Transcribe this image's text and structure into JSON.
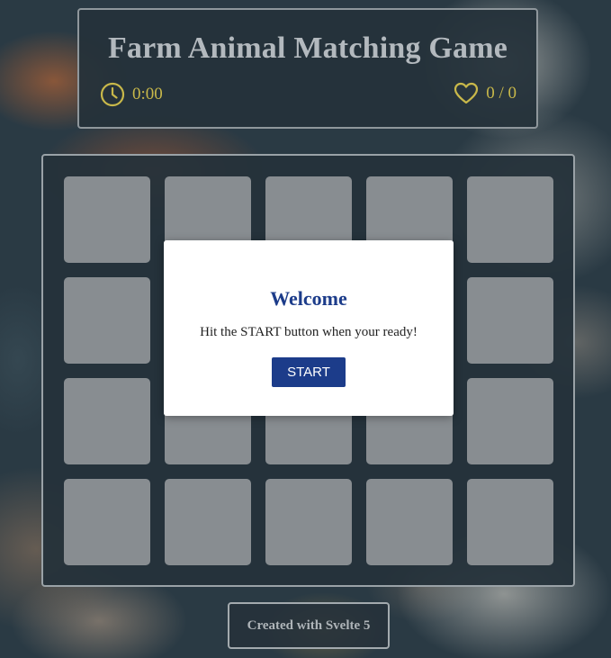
{
  "header": {
    "title": "Farm Animal Matching Game",
    "timer": {
      "icon": "clock-icon",
      "value": "0:00"
    },
    "score": {
      "icon": "heart-icon",
      "value": "0 / 0"
    }
  },
  "board": {
    "card_count": 20,
    "columns": 5,
    "rows": 4,
    "card_state": "face-down"
  },
  "modal": {
    "title": "Welcome",
    "message": "Hit the START button when your ready!",
    "start_label": "START"
  },
  "footer": {
    "credit": "Created with Svelte 5"
  },
  "colors": {
    "panel": "#25313a",
    "title_text": "#b3b9be",
    "stat_accent": "#c8b84a",
    "card_back": "#888d91",
    "modal_accent": "#1c3c8a"
  }
}
